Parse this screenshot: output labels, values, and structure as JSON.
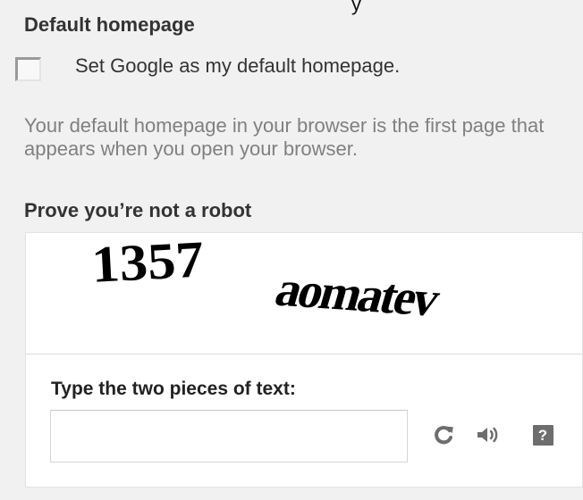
{
  "top_fragment": "y",
  "default_homepage": {
    "title": "Default homepage",
    "checkbox_label": "Set Google as my default homepage.",
    "checked": false,
    "help_text": "Your default homepage in your browser is the first page that appears when you open your browser."
  },
  "robot_check": {
    "title": "Prove you’re not a robot",
    "captcha_words": [
      "1357",
      "aomatev"
    ],
    "prompt": "Type the two pieces of text:",
    "input_value": "",
    "icons": {
      "refresh": "refresh-icon",
      "audio": "audio-icon",
      "help": "help-icon"
    },
    "help_glyph": "?"
  },
  "colors": {
    "page_background": "#f1f1f1",
    "help_text": "#808080",
    "captcha_background": "#ffffff",
    "icon_gray": "#6d6d6d"
  }
}
